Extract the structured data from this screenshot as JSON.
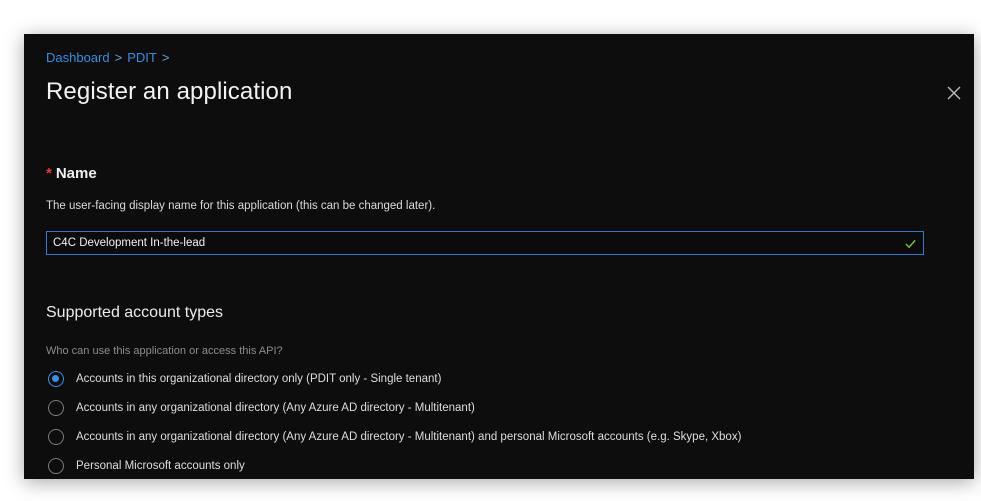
{
  "breadcrumb": {
    "items": [
      "Dashboard",
      "PDIT"
    ],
    "separator": ">"
  },
  "title": "Register an application",
  "name_field": {
    "required_mark": "*",
    "label": "Name",
    "description": "The user-facing display name for this application (this can be changed later).",
    "value": "C4C Development In-the-lead",
    "valid": true
  },
  "account_types": {
    "heading": "Supported account types",
    "question": "Who can use this application or access this API?",
    "options": [
      {
        "label": "Accounts in this organizational directory only (PDIT only - Single tenant)",
        "selected": true
      },
      {
        "label": "Accounts in any organizational directory (Any Azure AD directory - Multitenant)",
        "selected": false
      },
      {
        "label": "Accounts in any organizational directory (Any Azure AD directory - Multitenant) and personal Microsoft accounts (e.g. Skype, Xbox)",
        "selected": false
      },
      {
        "label": "Personal Microsoft accounts only",
        "selected": false
      }
    ]
  },
  "colors": {
    "accent": "#3b8de0",
    "background": "#0d0d0d",
    "required": "#e03b3b",
    "valid_check": "#7bc24b"
  },
  "icons": {
    "close": "close-icon",
    "valid": "checkmark-icon"
  }
}
